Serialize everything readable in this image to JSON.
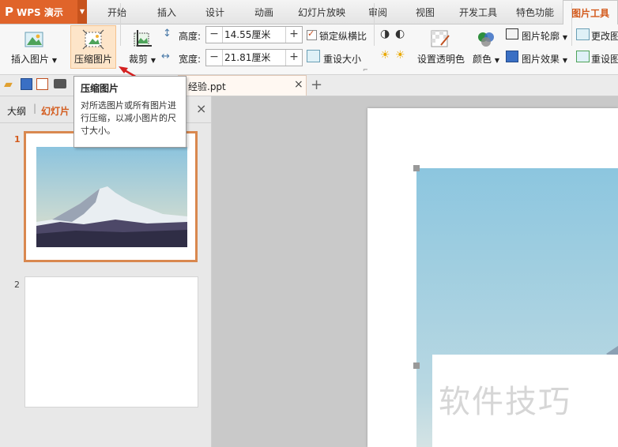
{
  "app": {
    "name": "WPS 演示",
    "logo": "P"
  },
  "menu_tabs": [
    {
      "label": "开始"
    },
    {
      "label": "插入"
    },
    {
      "label": "设计"
    },
    {
      "label": "动画"
    },
    {
      "label": "幻灯片放映"
    },
    {
      "label": "审阅"
    },
    {
      "label": "视图"
    },
    {
      "label": "开发工具"
    },
    {
      "label": "特色功能"
    },
    {
      "label": "图片工具"
    }
  ],
  "ribbon": {
    "insert_picture": "插入图片",
    "compress_picture": "压缩图片",
    "crop": "裁剪",
    "height_label": "高度:",
    "height_value": "14.55厘米",
    "width_label": "宽度:",
    "width_value": "21.81厘米",
    "lock_ratio": "锁定纵横比",
    "reset_size": "重设大小",
    "set_transparent": "设置透明色",
    "color": "颜色",
    "outline": "图片轮廓",
    "effects": "图片效果",
    "change_picture": "更改图",
    "reset_picture": "重设图"
  },
  "document": {
    "tab_title": "经验.ppt"
  },
  "pane": {
    "tab_outline": "大纲",
    "tab_slides": "幻灯片"
  },
  "slides": [
    {
      "number": "1"
    },
    {
      "number": "2"
    }
  ],
  "tooltip": {
    "title": "压缩图片",
    "body": "对所选图片或所有图片进行压缩，以减小图片的尺寸大小。"
  },
  "watermark": "软件技巧",
  "colors": {
    "accent": "#e0642a",
    "active_tab": "#d35a1c",
    "thumb_border": "#d9884f"
  }
}
